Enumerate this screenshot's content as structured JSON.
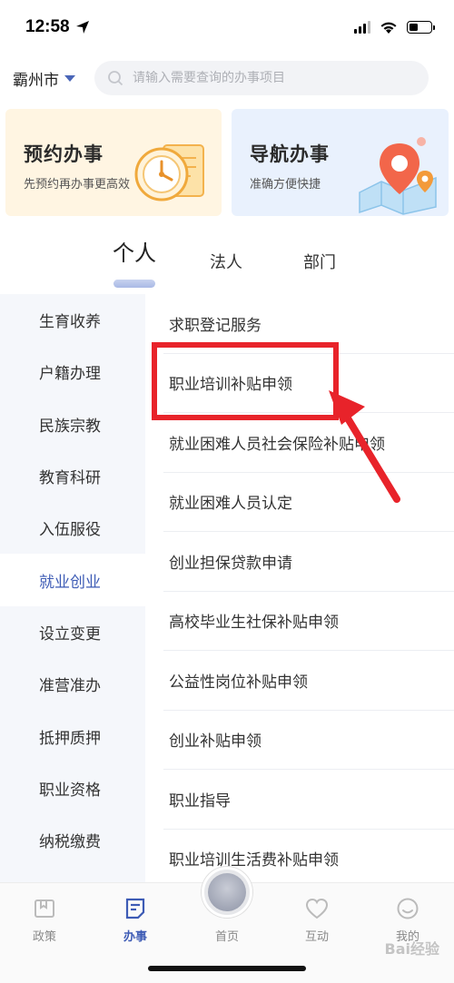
{
  "status": {
    "time": "12:58"
  },
  "header": {
    "city": "霸州市",
    "search_placeholder": "请输入需要查询的办事项目"
  },
  "banners": [
    {
      "title": "预约办事",
      "subtitle": "先预约再办事更高效"
    },
    {
      "title": "导航办事",
      "subtitle": "准确方便快捷"
    }
  ],
  "tabs": [
    {
      "label": "个人",
      "active": true
    },
    {
      "label": "法人"
    },
    {
      "label": "部门"
    }
  ],
  "categories": [
    {
      "label": "生育收养"
    },
    {
      "label": "户籍办理"
    },
    {
      "label": "民族宗教"
    },
    {
      "label": "教育科研"
    },
    {
      "label": "入伍服役"
    },
    {
      "label": "就业创业",
      "active": true
    },
    {
      "label": "设立变更"
    },
    {
      "label": "准营准办"
    },
    {
      "label": "抵押质押"
    },
    {
      "label": "职业资格"
    },
    {
      "label": "纳税缴费"
    }
  ],
  "services": [
    {
      "label": "求职登记服务"
    },
    {
      "label": "职业培训补贴申领",
      "highlighted": true
    },
    {
      "label": "就业困难人员社会保险补贴申领"
    },
    {
      "label": "就业困难人员认定"
    },
    {
      "label": "创业担保贷款申请"
    },
    {
      "label": "高校毕业生社保补贴申领"
    },
    {
      "label": "公益性岗位补贴申领"
    },
    {
      "label": "创业补贴申领"
    },
    {
      "label": "职业指导"
    },
    {
      "label": "职业培训生活费补贴申领"
    }
  ],
  "tabbar": [
    {
      "label": "政策"
    },
    {
      "label": "办事",
      "active": true
    },
    {
      "label": "首页"
    },
    {
      "label": "互动"
    },
    {
      "label": "我的"
    }
  ],
  "colors": {
    "accent": "#3d5bb5",
    "annotation": "#e8232a"
  },
  "watermark": "Bai经验"
}
